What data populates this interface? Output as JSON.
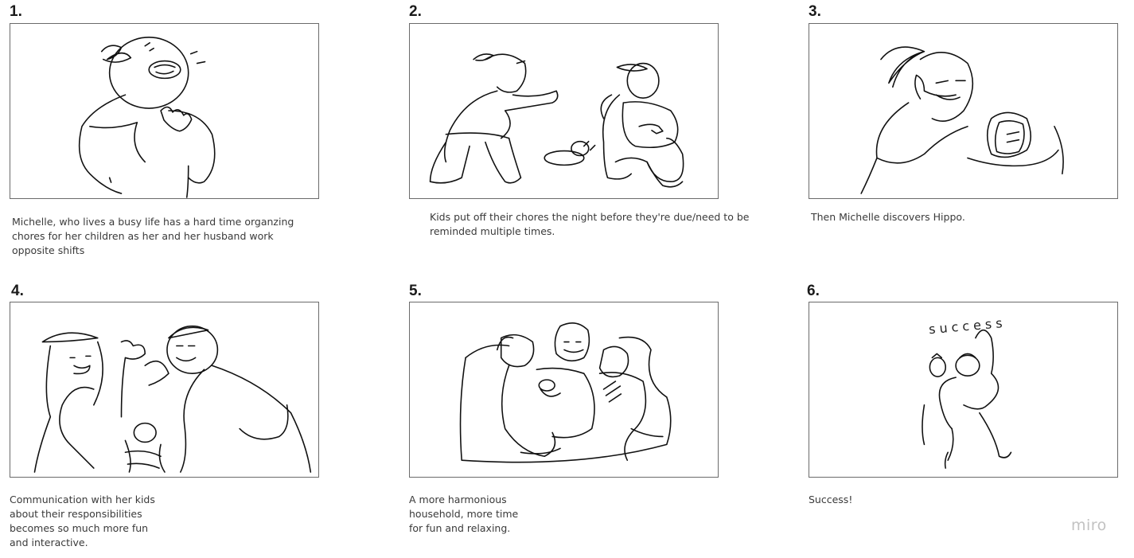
{
  "panels": [
    {
      "number": "1.",
      "caption": "Michelle, who lives a busy life has a hard time organzing\nchores for her children as her and her husband work\nopposite shifts"
    },
    {
      "number": "2.",
      "caption": "Kids put off their chores the night before they're due/need to be\nreminded multiple times."
    },
    {
      "number": "3.",
      "caption": "Then Michelle discovers Hippo."
    },
    {
      "number": "4.",
      "caption": "Communication with her kids\nabout their responsibilities\nbecomes so much more fun\nand interactive."
    },
    {
      "number": "5.",
      "caption": "A more harmonious\nhousehold, more time\nfor fun and relaxing."
    },
    {
      "number": "6.",
      "caption": "Success!"
    }
  ],
  "sketch_text": "success",
  "watermark": "miro"
}
